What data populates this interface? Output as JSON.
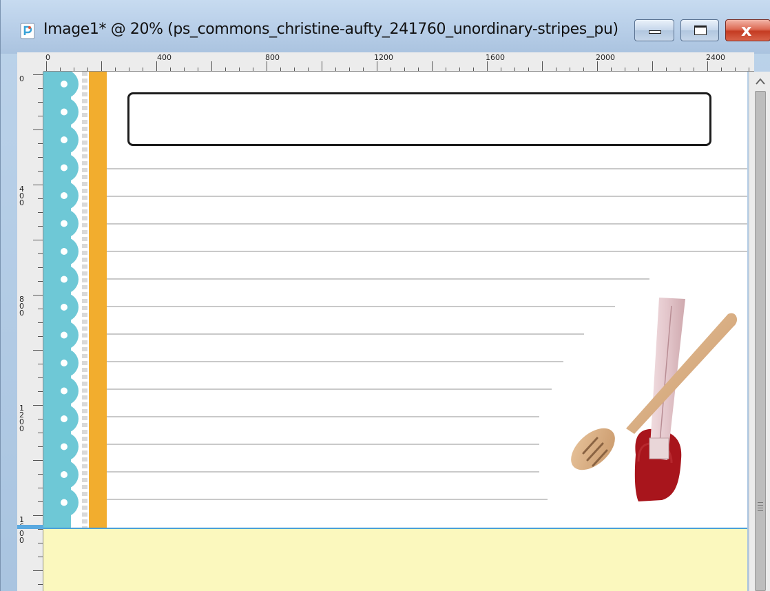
{
  "window": {
    "title": "Image1* @  20% (ps_commons_christine-aufty_241760_unordinary-stripes_pu)",
    "icons": {
      "app": "paint-shop-pro-icon",
      "minimize": "minimize-icon",
      "maximize": "maximize-icon",
      "close": "close-icon"
    },
    "close_glyph": "x"
  },
  "ruler": {
    "horizontal_labels": [
      "0",
      "400",
      "800",
      "1200",
      "1600",
      "2000",
      "2400"
    ],
    "vertical_labels": [
      "0",
      "400",
      "800",
      "1200",
      "1600"
    ]
  },
  "canvas": {
    "page_color": "#ffffff",
    "below_page_color": "#fbf8be",
    "scallop_color": "#6ec8d6",
    "stripe_color": "#f2ad2e",
    "guide_color": "#4aa0d8",
    "line_color": "#c9c9c9",
    "title_box_text": "",
    "decoration": "wooden-spoon-and-spatula-icon"
  }
}
